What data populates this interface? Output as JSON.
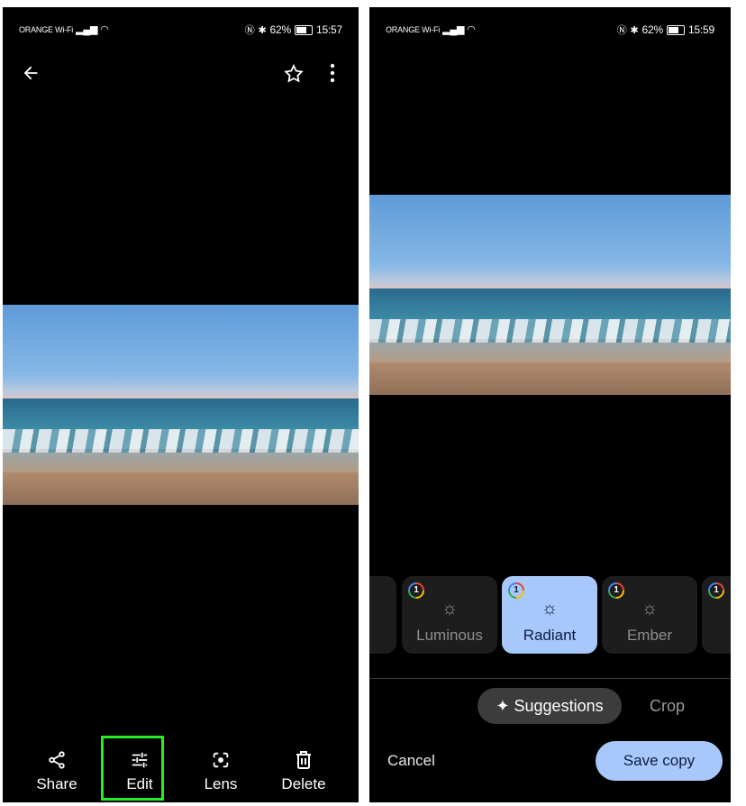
{
  "left_screen": {
    "status": {
      "carrier": "ORANGE Wi-Fi",
      "battery": "62%",
      "time": "15:57"
    },
    "topbar": {
      "back_icon": "arrow-left-icon",
      "favorite_icon": "star-outline-icon",
      "more_icon": "more-vert-icon"
    },
    "actions": [
      {
        "label": "Share",
        "icon": "share-icon"
      },
      {
        "label": "Edit",
        "icon": "tune-icon"
      },
      {
        "label": "Lens",
        "icon": "lens-icon"
      },
      {
        "label": "Delete",
        "icon": "trash-icon"
      }
    ],
    "highlight_color": "#22ee22"
  },
  "right_screen": {
    "status": {
      "carrier": "ORANGE Wi-Fi",
      "battery": "62%",
      "time": "15:59"
    },
    "filters": [
      {
        "label": "",
        "badge": "1"
      },
      {
        "label": "Luminous",
        "badge": "1"
      },
      {
        "label": "Radiant",
        "badge": "1",
        "selected": true
      },
      {
        "label": "Ember",
        "badge": "1"
      },
      {
        "label": "",
        "badge": "1"
      }
    ],
    "tabs": {
      "suggestions": "Suggestions",
      "crop": "Crop"
    },
    "buttons": {
      "cancel": "Cancel",
      "save": "Save copy"
    },
    "accent_color": "#a8c7fa"
  }
}
